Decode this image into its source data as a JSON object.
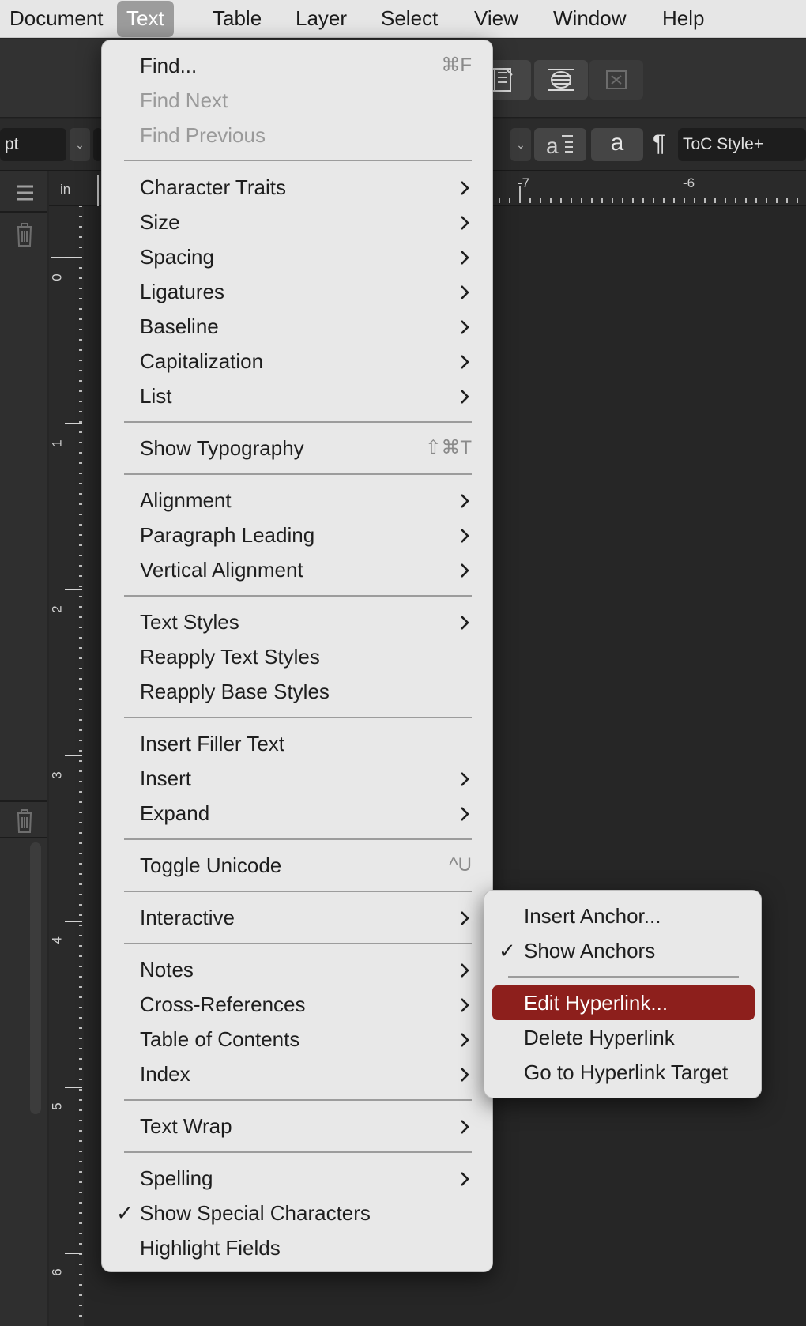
{
  "menubar": {
    "items": [
      {
        "label": "Document",
        "active": false
      },
      {
        "label": "Text",
        "active": true
      },
      {
        "label": "Table",
        "active": false
      },
      {
        "label": "Layer",
        "active": false
      },
      {
        "label": "Select",
        "active": false
      },
      {
        "label": "View",
        "active": false
      },
      {
        "label": "Window",
        "active": false
      },
      {
        "label": "Help",
        "active": false
      }
    ]
  },
  "controlbar": {
    "unit_field": "pt",
    "text_style_field": "ToC Style+",
    "char_button": "a",
    "pilcrow": "¶"
  },
  "ruler": {
    "unit": "in",
    "h_labels": [
      "-7",
      "-6"
    ],
    "v_labels": [
      "0",
      "1",
      "2",
      "3",
      "4",
      "5",
      "6"
    ]
  },
  "text_menu": {
    "find": {
      "label": "Find...",
      "shortcut": "⌘F"
    },
    "find_next": {
      "label": "Find Next"
    },
    "find_previous": {
      "label": "Find Previous"
    },
    "character_traits": {
      "label": "Character Traits"
    },
    "size": {
      "label": "Size"
    },
    "spacing": {
      "label": "Spacing"
    },
    "ligatures": {
      "label": "Ligatures"
    },
    "baseline": {
      "label": "Baseline"
    },
    "capitalization": {
      "label": "Capitalization"
    },
    "list": {
      "label": "List"
    },
    "show_typography": {
      "label": "Show Typography",
      "shortcut": "⇧⌘T"
    },
    "alignment": {
      "label": "Alignment"
    },
    "paragraph_leading": {
      "label": "Paragraph Leading"
    },
    "vertical_alignment": {
      "label": "Vertical Alignment"
    },
    "text_styles": {
      "label": "Text Styles"
    },
    "reapply_text_styles": {
      "label": "Reapply Text Styles"
    },
    "reapply_base_styles": {
      "label": "Reapply Base Styles"
    },
    "insert_filler_text": {
      "label": "Insert Filler Text"
    },
    "insert": {
      "label": "Insert"
    },
    "expand": {
      "label": "Expand"
    },
    "toggle_unicode": {
      "label": "Toggle Unicode",
      "shortcut": "^U"
    },
    "interactive": {
      "label": "Interactive"
    },
    "notes": {
      "label": "Notes"
    },
    "cross_references": {
      "label": "Cross-References"
    },
    "table_of_contents": {
      "label": "Table of Contents"
    },
    "index": {
      "label": "Index"
    },
    "text_wrap": {
      "label": "Text Wrap"
    },
    "spelling": {
      "label": "Spelling"
    },
    "show_special_characters": {
      "label": "Show Special Characters",
      "checked": true
    },
    "highlight_fields": {
      "label": "Highlight Fields"
    }
  },
  "interactive_submenu": {
    "insert_anchor": {
      "label": "Insert Anchor..."
    },
    "show_anchors": {
      "label": "Show Anchors",
      "checked": true
    },
    "edit_hyperlink": {
      "label": "Edit Hyperlink...",
      "highlighted": true
    },
    "delete_hyperlink": {
      "label": "Delete Hyperlink"
    },
    "go_to_hyperlink_target": {
      "label": "Go to Hyperlink Target"
    }
  },
  "colors": {
    "highlight": "#8d1f1c",
    "menu_bg": "#e8e8e8",
    "app_bg": "#262626"
  }
}
